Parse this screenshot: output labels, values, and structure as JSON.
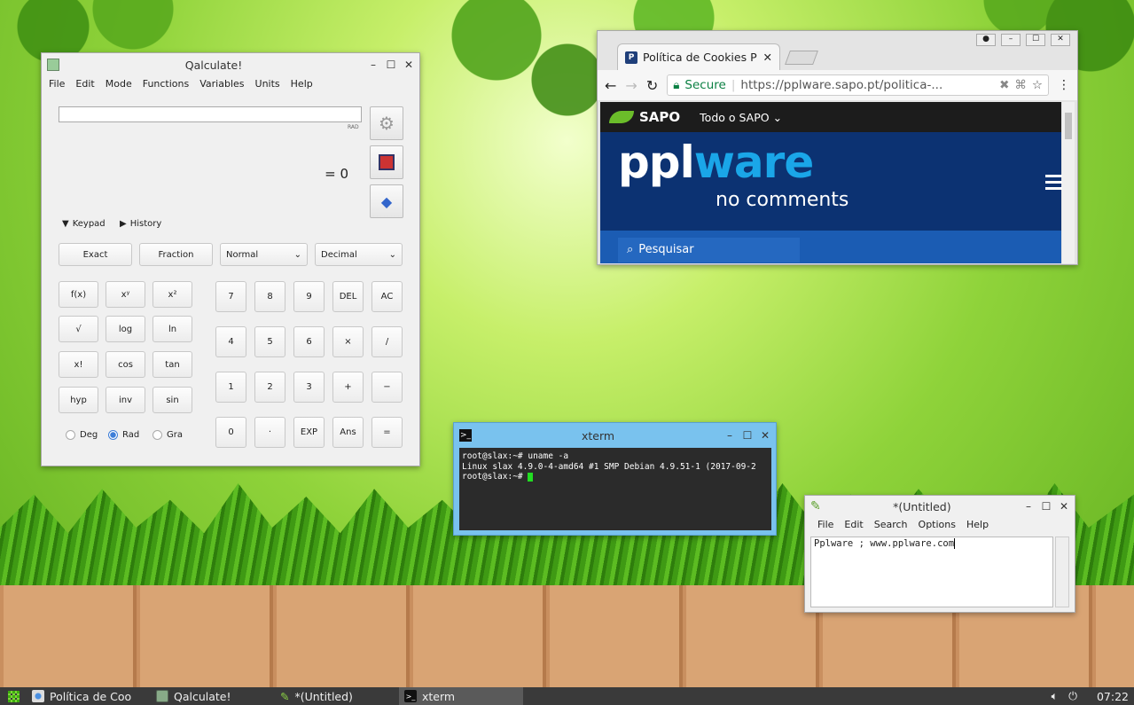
{
  "qalculate": {
    "title": "Qalculate!",
    "menu": [
      "File",
      "Edit",
      "Mode",
      "Functions",
      "Variables",
      "Units",
      "Help"
    ],
    "rad_label": "RAD",
    "result": "= 0",
    "keypad_toggle": "Keypad",
    "history_toggle": "History",
    "exact": "Exact",
    "fraction": "Fraction",
    "mode_select": "Normal",
    "base_select": "Decimal",
    "fn_buttons": [
      "f(x)",
      "xʸ",
      "x²",
      "√",
      "log",
      "ln",
      "x!",
      "cos",
      "tan",
      "hyp",
      "inv",
      "sin"
    ],
    "num_buttons": [
      "7",
      "8",
      "9",
      "DEL",
      "AC",
      "4",
      "5",
      "6",
      "×",
      "/",
      "1",
      "2",
      "3",
      "+",
      "−",
      "0",
      "·",
      "EXP",
      "Ans",
      "="
    ],
    "angle": {
      "deg": "Deg",
      "rad": "Rad",
      "gra": "Gra",
      "selected": "Rad"
    }
  },
  "chrome": {
    "tab_title": "Política de Cookies P",
    "secure_label": "Secure",
    "url": "https://pplware.sapo.pt/politica-...",
    "sapo_label": "SAPO",
    "todo_label": "Todo o SAPO",
    "logo_ppl": "ppl",
    "logo_ware": "ware",
    "tagline": "no comments",
    "search_placeholder": "Pesquisar"
  },
  "xterm": {
    "title": "xterm",
    "lines": [
      "root@slax:~# uname -a",
      "Linux slax 4.9.0-4-amd64 #1 SMP Debian 4.9.51-1 (2017-09-2",
      "root@slax:~# "
    ]
  },
  "leafpad": {
    "title": "*(Untitled)",
    "menu": [
      "File",
      "Edit",
      "Search",
      "Options",
      "Help"
    ],
    "content": "Pplware ; www.pplware.com"
  },
  "taskbar": {
    "items": [
      "Política de Coo",
      "Qalculate!",
      "*(Untitled)",
      "xterm"
    ],
    "active": "xterm",
    "clock": "07:22"
  }
}
